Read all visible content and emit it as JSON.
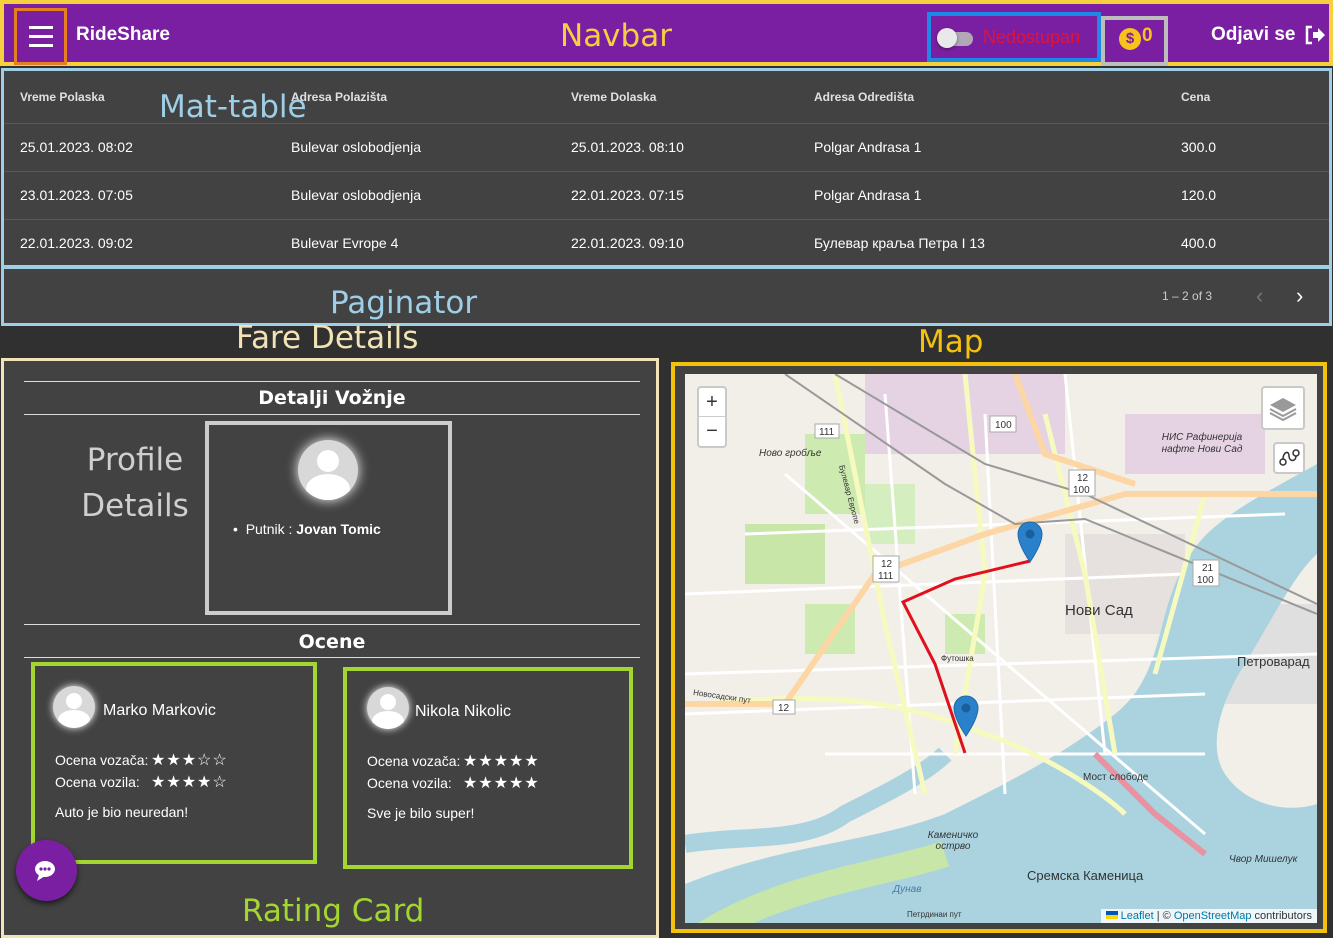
{
  "navbar": {
    "brand": "RideShare",
    "availability_label": "Nedostupan",
    "coins": "0",
    "coin_symbol": "$",
    "logout_label": "Odjavi se",
    "color": "#7b1fa2"
  },
  "table": {
    "headers": [
      "Vreme Polaska",
      "Adresa Polazišta",
      "Vreme Dolaska",
      "Adresa Odredišta",
      "Cena"
    ],
    "rows": [
      [
        "25.01.2023. 08:02",
        "Bulevar oslobodjenja",
        "25.01.2023. 08:10",
        "Polgar Andrasa 1",
        "300.0"
      ],
      [
        "23.01.2023. 07:05",
        "Bulevar oslobodjenja",
        "22.01.2023. 07:15",
        "Polgar Andrasa 1",
        "120.0"
      ],
      [
        "22.01.2023. 09:02",
        "Bulevar Evrope 4",
        "22.01.2023. 09:10",
        "Булевар краља Петра I 13",
        "400.0"
      ]
    ]
  },
  "paginator": {
    "range": "1 – 2 of 3"
  },
  "fare": {
    "title": "Detalji Vožnje",
    "passenger_label": "Putnik",
    "passenger_name": "Jovan Tomic",
    "ratings_title": "Ocene",
    "driver_rating_label": "Ocena vozača:",
    "vehicle_rating_label": "Ocena vozila:",
    "ratings": [
      {
        "name": "Marko Markovic",
        "driver_stars": 3,
        "vehicle_stars": 4,
        "comment": "Auto je bio neuredan!"
      },
      {
        "name": "Nikola Nikolic",
        "driver_stars": 5,
        "vehicle_stars": 5,
        "comment": "Sve je bilo super!"
      }
    ]
  },
  "map": {
    "zoom_in": "+",
    "zoom_out": "−",
    "attribution_leaflet": "Leaflet",
    "attribution_sep": " | © ",
    "attribution_osm": "OpenStreetMap",
    "attribution_rest": " contributors",
    "labels": {
      "novi_sad": "Нови Сад",
      "petrovaradin": "Петроварад",
      "sremska": "Сремска Каменица",
      "novo_groblje": "Ново гробље",
      "most": "Мост слободе",
      "kamenicko": "Каменичко острво",
      "nis": "НИС Рафинерија нафте Нови Сад",
      "futoska": "Футошка",
      "bulevar_evrope": "Булевар Европе",
      "novosadski": "Новосадски пут",
      "dunav": "Дунав",
      "cvor": "Чвор Мишелук",
      "peterhazi": "Петрдинаи пут"
    },
    "road_badges": [
      "100",
      "111",
      "12 100",
      "12 111",
      "21 100",
      "12"
    ]
  },
  "annotations": {
    "navbar": "Navbar",
    "mat_table": "Mat-table",
    "paginator": "Paginator",
    "fare_details": "Fare Details",
    "map": "Map",
    "profile_details": "Profile Details",
    "rating_card": "Rating Card"
  }
}
